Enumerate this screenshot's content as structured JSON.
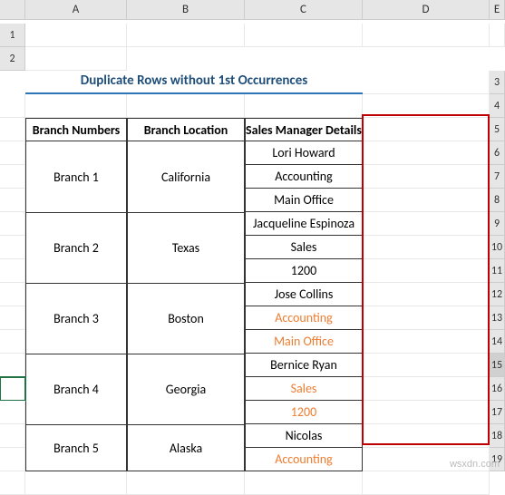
{
  "columns": [
    "A",
    "B",
    "C",
    "D",
    "E"
  ],
  "row_count": 19,
  "active_row": 15,
  "title": "Duplicate Rows without 1st Occurrences",
  "headers": {
    "branch_numbers": "Branch Numbers",
    "branch_location": "Branch Location",
    "sales_manager_details": "Sales Manager Details"
  },
  "branches": [
    {
      "number": "Branch 1",
      "location": "California",
      "details": [
        "Lori Howard",
        "Accounting",
        "Main Office"
      ],
      "hl": [
        false,
        false,
        false
      ]
    },
    {
      "number": "Branch 2",
      "location": "Texas",
      "details": [
        "Jacqueline Espinoza",
        "Sales",
        "1200"
      ],
      "hl": [
        false,
        false,
        false
      ]
    },
    {
      "number": "Branch 3",
      "location": "Boston",
      "details": [
        "Jose Collins",
        "Accounting",
        "Main Office"
      ],
      "hl": [
        false,
        true,
        true
      ]
    },
    {
      "number": "Branch 4",
      "location": "Georgia",
      "details": [
        "Bernice Ryan",
        "Sales",
        "1200"
      ],
      "hl": [
        false,
        true,
        true
      ]
    },
    {
      "number": "Branch 5",
      "location": "Alaska",
      "details": [
        "Nicolas",
        "Accounting"
      ],
      "hl": [
        false,
        true
      ]
    }
  ],
  "watermark": "wsxdn.com",
  "chart_data": {
    "type": "table",
    "title": "Duplicate Rows without 1st Occurrences",
    "columns": [
      "Branch Numbers",
      "Branch Location",
      "Sales Manager Details"
    ],
    "rows": [
      [
        "Branch 1",
        "California",
        "Lori Howard"
      ],
      [
        "Branch 1",
        "California",
        "Accounting"
      ],
      [
        "Branch 1",
        "California",
        "Main Office"
      ],
      [
        "Branch 2",
        "Texas",
        "Jacqueline Espinoza"
      ],
      [
        "Branch 2",
        "Texas",
        "Sales"
      ],
      [
        "Branch 2",
        "Texas",
        "1200"
      ],
      [
        "Branch 3",
        "Boston",
        "Jose Collins"
      ],
      [
        "Branch 3",
        "Boston",
        "Accounting"
      ],
      [
        "Branch 3",
        "Boston",
        "Main Office"
      ],
      [
        "Branch 4",
        "Georgia",
        "Bernice Ryan"
      ],
      [
        "Branch 4",
        "Georgia",
        "Sales"
      ],
      [
        "Branch 4",
        "Georgia",
        "1200"
      ],
      [
        "Branch 5",
        "Alaska",
        "Nicolas"
      ],
      [
        "Branch 5",
        "Alaska",
        "Accounting"
      ]
    ],
    "highlighted_duplicates": [
      {
        "row": 8,
        "col": 2
      },
      {
        "row": 9,
        "col": 2
      },
      {
        "row": 11,
        "col": 2
      },
      {
        "row": 12,
        "col": 2
      },
      {
        "row": 14,
        "col": 2
      }
    ]
  }
}
